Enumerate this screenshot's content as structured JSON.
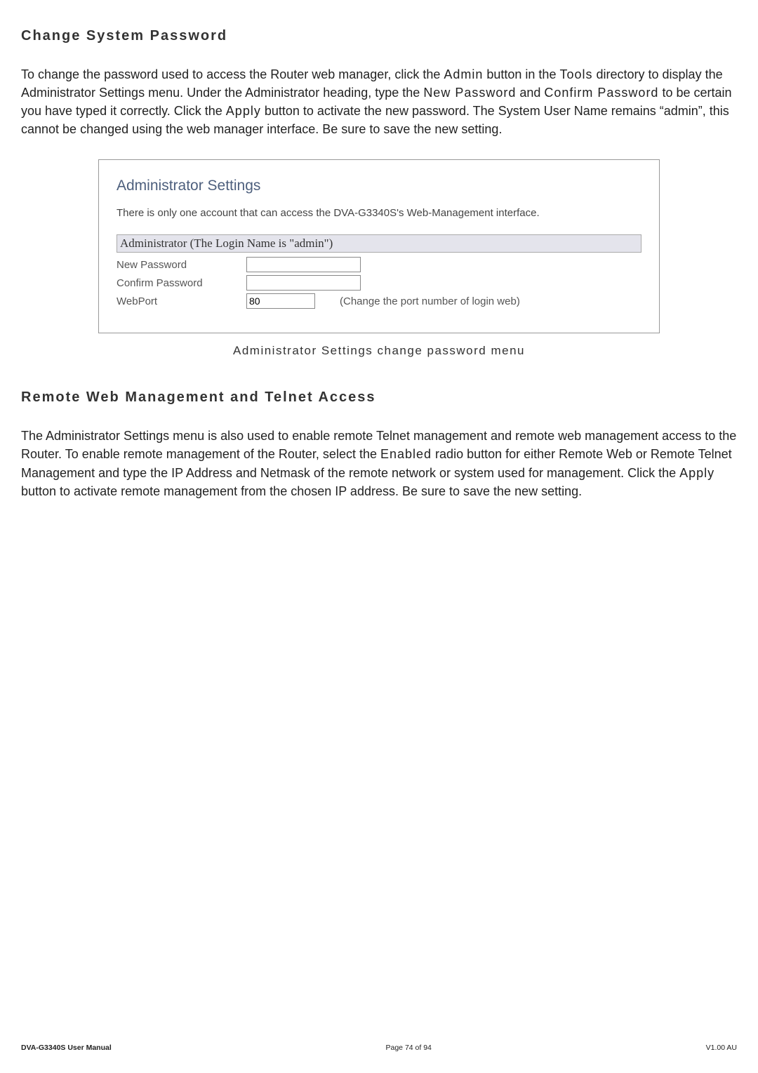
{
  "heading1": "Change System Password",
  "para1_parts": {
    "t1": "To change the password used to access the Router web manager, click the ",
    "admin": "Admin",
    "t2": " button in the ",
    "tools": "Tools",
    "t3": " directory to display the Administrator Settings menu. Under the Administrator heading, type the ",
    "newpw": "New Password",
    "t4": " and ",
    "confpw": "Confirm Password",
    "t5": " to be certain you have typed it correctly. Click the ",
    "apply": "Apply",
    "t6": " button to activate the new password.   The System User Name remains “admin”, this cannot be changed using the web manager interface. Be sure to save the new setting."
  },
  "box": {
    "title": "Administrator Settings",
    "desc": "There is only one account that can access the DVA-G3340S's Web-Management interface.",
    "subheader": "Administrator (The Login Name is \"admin\")",
    "row_newpw": "New Password",
    "row_confpw": "Confirm Password",
    "row_webport": "WebPort",
    "webport_value": "80",
    "webport_hint": "(Change the port number of login web)"
  },
  "caption1": "Administrator Settings change password menu",
  "heading2": "Remote Web Management and Telnet Access",
  "para2_parts": {
    "t1": "The Administrator Settings menu is also used to enable remote Telnet management and remote web management access to the Router. To enable remote management of the Router, select the ",
    "enabled": "Enabled",
    "t2": " radio button for either Remote Web or Remote Telnet Management and type the IP Address and Netmask of the remote network or system used for management. Click the ",
    "apply": "Apply",
    "t3": " button to activate remote management from the chosen IP address. Be sure to save the new setting."
  },
  "footer": {
    "left": "DVA-G3340S User Manual",
    "center": "Page 74 of 94",
    "right": "V1.00 AU"
  }
}
